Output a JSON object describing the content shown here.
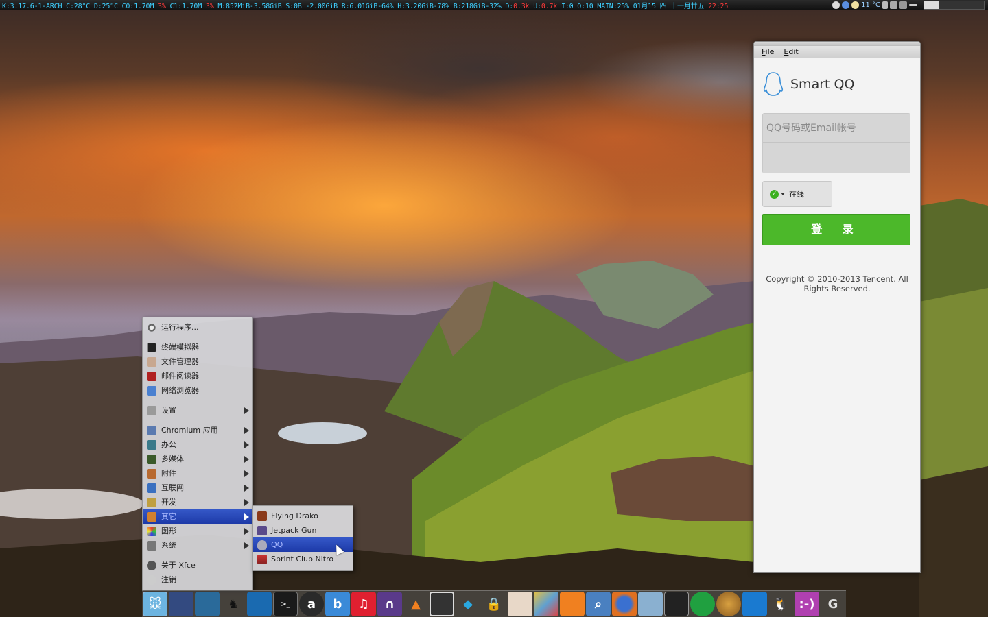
{
  "topbar": {
    "conky_a": "K:3.17.6-1-ARCH C:28°C D:25°C C0:1.70M ",
    "conky_a_red": "3%",
    "conky_b": " C1:1.70M ",
    "conky_b_red": "3%",
    "conky_c": " M:852MiB-3.58GiB S:0B -2.00GiB R:6.01GiB-64% H:3.20GiB-78% B:218GiB-32% D:",
    "conky_d_red": "0.3k",
    "conky_e": " U:",
    "conky_e_red": "0.7k",
    "conky_f": " I:0 O:10 MAIN:25% 01月15 四 十一月廿五 ",
    "conky_time": "22:25",
    "weather": "11 °C"
  },
  "menu": {
    "run": "运行程序...",
    "terminal": "终端模拟器",
    "files": "文件管理器",
    "mail": "邮件阅读器",
    "browser": "网络浏览器",
    "settings": "设置",
    "chromium": "Chromium 应用",
    "office": "办公",
    "multimedia": "多媒体",
    "accessories": "附件",
    "internet": "互联网",
    "development": "开发",
    "other": "其它",
    "graphics": "图形",
    "system": "系统",
    "about": "关于 Xfce",
    "logout": "注销"
  },
  "submenu": {
    "items": [
      "Flying Drako",
      "Jetpack Gun",
      "QQ",
      "Sprint Club Nitro"
    ]
  },
  "qq": {
    "menu_file": "File",
    "menu_edit": "Edit",
    "title": "Smart QQ",
    "account_placeholder": "QQ号码或Email帐号",
    "status": "在线",
    "login": "登 录",
    "copyright": "Copyright © 2010-2013 Tencent. All Rights Reserved."
  },
  "colors": {
    "login_green": "#4cb82a",
    "menu_highlight": "#1d3aa8",
    "conky_blue": "#3fd0ff",
    "conky_red": "#ff3a3a"
  },
  "dock": {
    "apps": [
      "xfce-start-icon",
      "calculator-icon",
      "screenshot-icon",
      "tux-icon",
      "waveform-icon",
      "terminal-icon",
      "audacity-icon",
      "bing-icon",
      "music-icon",
      "headphones-icon",
      "vlc-icon",
      "tv-icon",
      "kodi-icon",
      "lock-icon",
      "eye-icon",
      "paint-icon",
      "rss-icon",
      "search-icon",
      "firefox-icon",
      "qq-settings-icon",
      "monitor-icon",
      "cloud-icon",
      "nut-icon",
      "chart-icon",
      "qq-penguin-icon",
      "chat-icon",
      "google-icon"
    ]
  }
}
